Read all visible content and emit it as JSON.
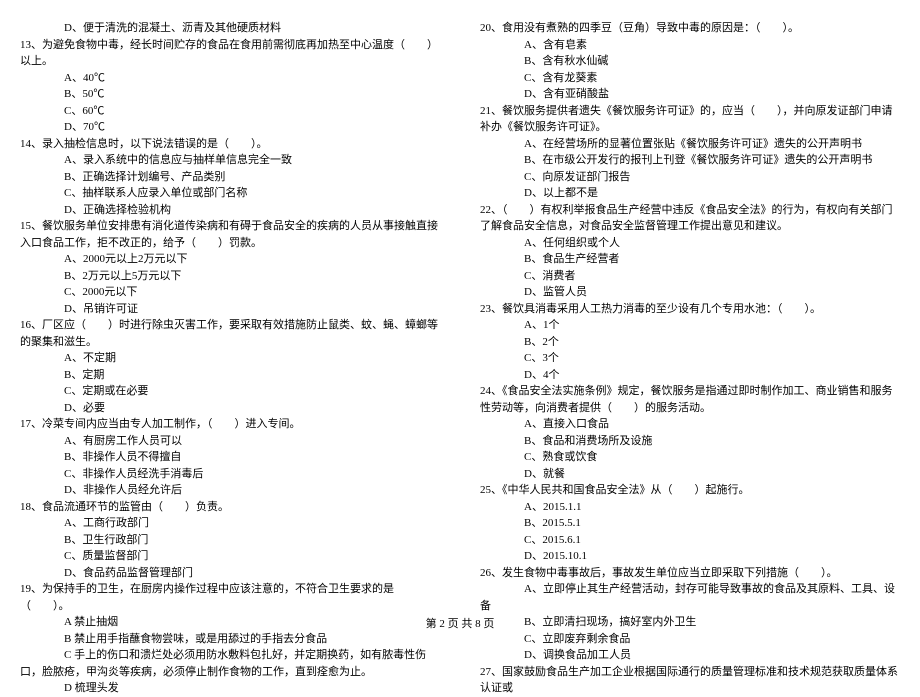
{
  "left": [
    {
      "cls": "opt",
      "t": "D、便于清洗的混凝土、沥青及其他硬质材料"
    },
    {
      "cls": "noindent",
      "t": "13、为避免食物中毒，经长时间贮存的食品在食用前需彻底再加热至中心温度（　　）以上。"
    },
    {
      "cls": "opt",
      "t": "A、40℃"
    },
    {
      "cls": "opt",
      "t": "B、50℃"
    },
    {
      "cls": "opt",
      "t": "C、60℃"
    },
    {
      "cls": "opt",
      "t": "D、70℃"
    },
    {
      "cls": "noindent",
      "t": "14、录入抽检信息时，以下说法错误的是（　　）。"
    },
    {
      "cls": "opt",
      "t": "A、录入系统中的信息应与抽样单信息完全一致"
    },
    {
      "cls": "opt",
      "t": "B、正确选择计划编号、产品类别"
    },
    {
      "cls": "opt",
      "t": "C、抽样联系人应录入单位或部门名称"
    },
    {
      "cls": "opt",
      "t": "D、正确选择检验机构"
    },
    {
      "cls": "noindent",
      "t": "15、餐饮服务单位安排患有消化道传染病和有碍于食品安全的疾病的人员从事接触直接入口食品工作，拒不改正的，给予（　　）罚款。"
    },
    {
      "cls": "opt",
      "t": "A、2000元以上2万元以下"
    },
    {
      "cls": "opt",
      "t": "B、2万元以上5万元以下"
    },
    {
      "cls": "opt",
      "t": "C、2000元以下"
    },
    {
      "cls": "opt",
      "t": "D、吊销许可证"
    },
    {
      "cls": "noindent",
      "t": "16、厂区应（　　）时进行除虫灭害工作，要采取有效措施防止鼠类、蚊、蝇、蟑螂等的聚集和滋生。"
    },
    {
      "cls": "opt",
      "t": "A、不定期"
    },
    {
      "cls": "opt",
      "t": "B、定期"
    },
    {
      "cls": "opt",
      "t": "C、定期或在必要"
    },
    {
      "cls": "opt",
      "t": "D、必要"
    },
    {
      "cls": "noindent",
      "t": "17、冷菜专间内应当由专人加工制作，（　　）进入专间。"
    },
    {
      "cls": "opt",
      "t": "A、有厨房工作人员可以"
    },
    {
      "cls": "opt",
      "t": "B、非操作人员不得擅自"
    },
    {
      "cls": "opt",
      "t": "C、非操作人员经洗手消毒后"
    },
    {
      "cls": "opt",
      "t": "D、非操作人员经允许后"
    },
    {
      "cls": "noindent",
      "t": "18、食品流通环节的监管由（　　）负责。"
    },
    {
      "cls": "opt",
      "t": "A、工商行政部门"
    },
    {
      "cls": "opt",
      "t": "B、卫生行政部门"
    },
    {
      "cls": "opt",
      "t": "C、质量监督部门"
    },
    {
      "cls": "opt",
      "t": "D、食品药品监督管理部门"
    },
    {
      "cls": "noindent",
      "t": "19、为保持手的卫生，在厨房内操作过程中应该注意的，不符合卫生要求的是（　　）。"
    },
    {
      "cls": "opt",
      "t": "A 禁止抽烟"
    },
    {
      "cls": "opt",
      "t": "B 禁止用手指蘸食物尝味，或是用舔过的手指去分食品"
    },
    {
      "cls": "opt",
      "t": "C 手上的伤口和溃烂处必须用防水敷料包扎好，并定期换药，如有脓毒性伤口，脸脓疮，甲沟炎等疾病，必须停止制作食物的工作，直到痊愈为止。"
    },
    {
      "cls": "opt",
      "t": "D 梳理头发"
    }
  ],
  "right": [
    {
      "cls": "noindent",
      "t": "20、食用没有煮熟的四季豆（豆角）导致中毒的原因是：（　　）。"
    },
    {
      "cls": "opt",
      "t": "A、含有皂素"
    },
    {
      "cls": "opt",
      "t": "B、含有秋水仙碱"
    },
    {
      "cls": "opt",
      "t": "C、含有龙葵素"
    },
    {
      "cls": "opt",
      "t": "D、含有亚硝酸盐"
    },
    {
      "cls": "noindent",
      "t": "21、餐饮服务提供者遗失《餐饮服务许可证》的，应当（　　），并向原发证部门申请补办《餐饮服务许可证》。"
    },
    {
      "cls": "opt",
      "t": "A、在经营场所的显著位置张贴《餐饮服务许可证》遗失的公开声明书"
    },
    {
      "cls": "opt",
      "t": "B、在市级公开发行的报刊上刊登《餐饮服务许可证》遗失的公开声明书"
    },
    {
      "cls": "opt",
      "t": "C、向原发证部门报告"
    },
    {
      "cls": "opt",
      "t": "D、以上都不是"
    },
    {
      "cls": "noindent",
      "t": "22、（　　）有权利举报食品生产经营中违反《食品安全法》的行为，有权向有关部门了解食品安全信息，对食品安全监督管理工作提出意见和建议。"
    },
    {
      "cls": "opt",
      "t": "A、任何组织或个人"
    },
    {
      "cls": "opt",
      "t": "B、食品生产经营者"
    },
    {
      "cls": "opt",
      "t": "C、消费者"
    },
    {
      "cls": "opt",
      "t": "D、监管人员"
    },
    {
      "cls": "noindent",
      "t": "23、餐饮具消毒采用人工热力消毒的至少设有几个专用水池：（　　）。"
    },
    {
      "cls": "opt",
      "t": "A、1个"
    },
    {
      "cls": "opt",
      "t": "B、2个"
    },
    {
      "cls": "opt",
      "t": "C、3个"
    },
    {
      "cls": "opt",
      "t": "D、4个"
    },
    {
      "cls": "noindent",
      "t": "24、《食品安全法实施条例》规定，餐饮服务是指通过即时制作加工、商业销售和服务性劳动等，向消费者提供（　　）的服务活动。"
    },
    {
      "cls": "opt",
      "t": "A、直接入口食品"
    },
    {
      "cls": "opt",
      "t": "B、食品和消费场所及设施"
    },
    {
      "cls": "opt",
      "t": "C、熟食或饮食"
    },
    {
      "cls": "opt",
      "t": "D、就餐"
    },
    {
      "cls": "noindent",
      "t": "25、《中华人民共和国食品安全法》从（　　）起施行。"
    },
    {
      "cls": "opt",
      "t": "A、2015.1.1"
    },
    {
      "cls": "opt",
      "t": "B、2015.5.1"
    },
    {
      "cls": "opt",
      "t": "C、2015.6.1"
    },
    {
      "cls": "opt",
      "t": "D、2015.10.1"
    },
    {
      "cls": "noindent",
      "t": "26、发生食物中毒事故后，事故发生单位应当立即采取下列措施（　　）。"
    },
    {
      "cls": "opt",
      "t": "A、立即停止其生产经营活动，封存可能导致事故的食品及其原料、工具、设备"
    },
    {
      "cls": "opt",
      "t": "B、立即清扫现场，搞好室内外卫生"
    },
    {
      "cls": "opt",
      "t": "C、立即废弃剩余食品"
    },
    {
      "cls": "opt",
      "t": "D、调换食品加工人员"
    },
    {
      "cls": "noindent",
      "t": "27、国家鼓励食品生产加工企业根据国际通行的质量管理标准和技术规范获取质量体系认证或"
    }
  ],
  "footer": "第 2 页 共 8 页"
}
